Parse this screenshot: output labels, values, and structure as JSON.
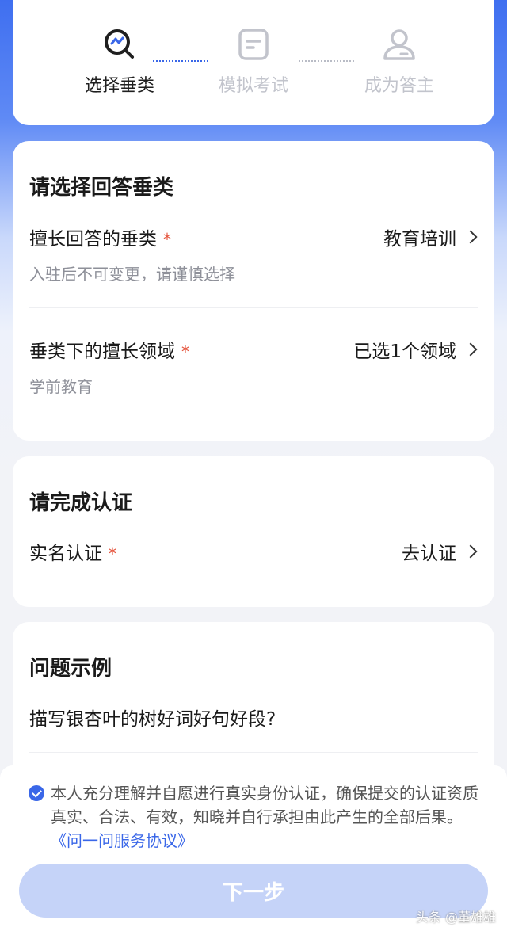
{
  "stepper": {
    "steps": [
      {
        "label": "选择垂类",
        "icon": "search-chart-icon",
        "state": "active"
      },
      {
        "label": "模拟考试",
        "icon": "document-icon",
        "state": "inactive"
      },
      {
        "label": "成为答主",
        "icon": "user-icon",
        "state": "inactive"
      }
    ]
  },
  "category_section": {
    "title": "请选择回答垂类",
    "rows": [
      {
        "label": "擅长回答的垂类",
        "required": "*",
        "value": "教育培训",
        "hint": "入驻后不可变更，请谨慎选择"
      },
      {
        "label": "垂类下的擅长领域",
        "required": "*",
        "value": "已选1个领域",
        "hint": "学前教育"
      }
    ]
  },
  "verify_section": {
    "title": "请完成认证",
    "row": {
      "label": "实名认证",
      "required": "*",
      "value": "去认证"
    }
  },
  "example_section": {
    "title": "问题示例",
    "question": "描写银杏叶的树好词好句好段?"
  },
  "agreement": {
    "checked": true,
    "text": "本人充分理解并自愿进行真实身份认证，确保提交的认证资质真实、合法、有效，知晓并自行承担由此产生的全部后果。",
    "link": "《问一问服务协议》"
  },
  "next_button": {
    "label": "下一步"
  },
  "watermark": "头条 @董雄雄",
  "colors": {
    "accent": "#3a67e8",
    "required": "#e5533c",
    "button_disabled": "#c5d3f8"
  }
}
